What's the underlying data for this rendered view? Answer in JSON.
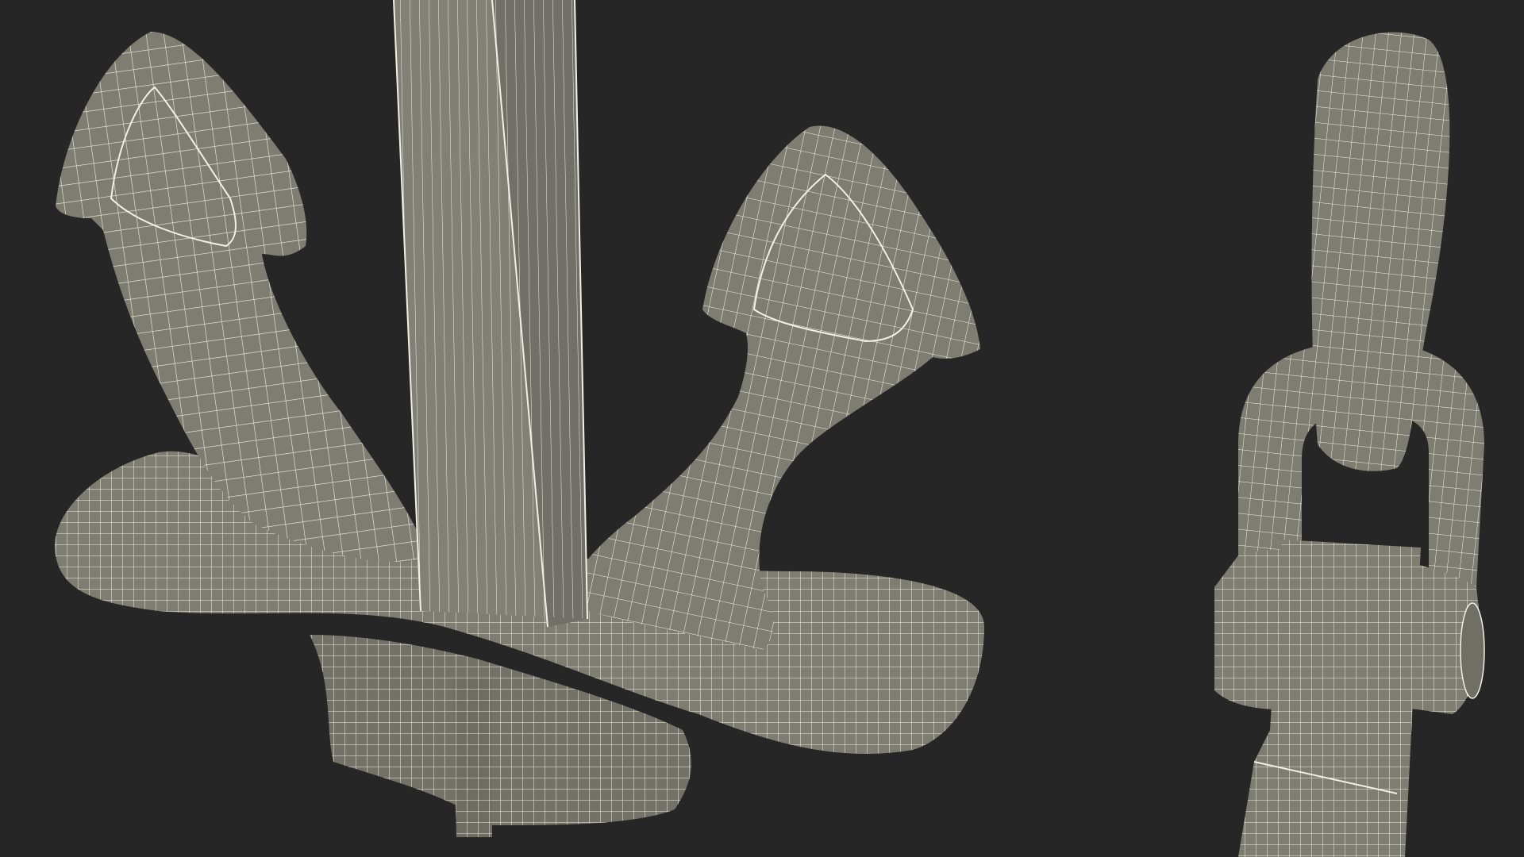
{
  "scene": {
    "background_color": "#262626",
    "mesh_fill_color": "#7d7d72",
    "mesh_fill_shadow": "#68685f",
    "wire_color": "#f2f0e2",
    "objects": [
      "anchor-render",
      "chain-link-render"
    ]
  }
}
